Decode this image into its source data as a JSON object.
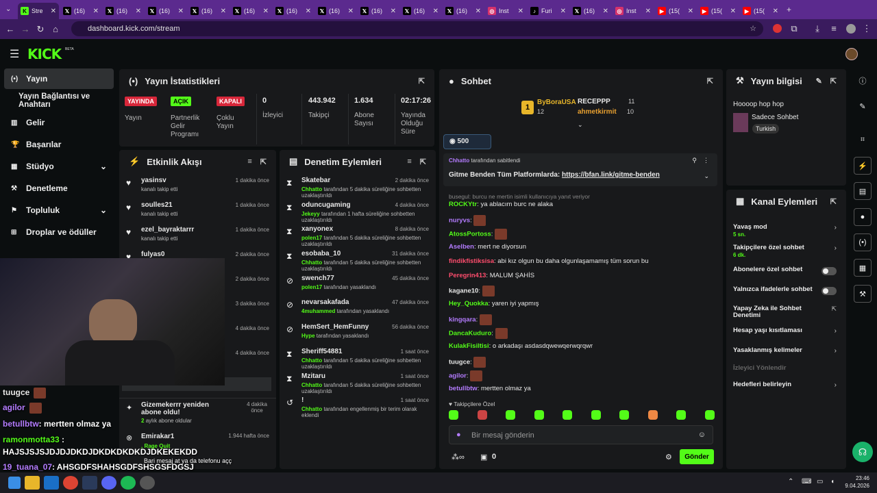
{
  "browser": {
    "tabs": [
      {
        "label": "Stre",
        "icon": "kick-icon",
        "color": "#53fc18",
        "active": true
      },
      {
        "label": "(16)",
        "icon": "x-icon"
      },
      {
        "label": "(16)",
        "icon": "x-icon"
      },
      {
        "label": "(16)",
        "icon": "x-icon"
      },
      {
        "label": "(16)",
        "icon": "x-icon"
      },
      {
        "label": "(16)",
        "icon": "x-icon"
      },
      {
        "label": "(16)",
        "icon": "x-icon"
      },
      {
        "label": "(16)",
        "icon": "x-icon"
      },
      {
        "label": "(16)",
        "icon": "x-icon"
      },
      {
        "label": "(16)",
        "icon": "x-icon"
      },
      {
        "label": "(16)",
        "icon": "x-icon"
      },
      {
        "label": "Inst",
        "icon": "instagram-icon"
      },
      {
        "label": "Furi",
        "icon": "tiktok-icon"
      },
      {
        "label": "(16)",
        "icon": "x-icon"
      },
      {
        "label": "Inst",
        "icon": "instagram-icon"
      },
      {
        "label": "(15(",
        "icon": "youtube-icon"
      },
      {
        "label": "(15(",
        "icon": "youtube-icon"
      },
      {
        "label": "(15(",
        "icon": "youtube-icon"
      }
    ],
    "url": "dashboard.kick.com/stream"
  },
  "kick": {
    "logo": "KICK",
    "beta": "BETA"
  },
  "sidebar": {
    "items": [
      {
        "label": "Yayın",
        "icon": "broadcast-icon",
        "active": true
      },
      {
        "label": "Yayın Bağlantısı ve Anahtarı",
        "icon": ""
      },
      {
        "label": "Gelir",
        "icon": "revenue-icon"
      },
      {
        "label": "Başarılar",
        "icon": "trophy-icon"
      },
      {
        "label": "Stüdyo",
        "icon": "studio-icon",
        "chev": true
      },
      {
        "label": "Denetleme",
        "icon": "wrench-icon"
      },
      {
        "label": "Topluluk",
        "icon": "community-icon",
        "chev": true
      },
      {
        "label": "Droplar ve ödüller",
        "icon": "gift-icon"
      }
    ]
  },
  "stats": {
    "title": "Yayın İstatistikleri",
    "live_badge": "YAYINDA",
    "live_label": "Yayın",
    "partner_badge": "AÇIK",
    "partner_label": "Partnerlik Gelir Programı",
    "multi_badge": "KAPALI",
    "multi_label": "Çoklu Yayın",
    "viewers": "0",
    "viewers_label": "İzleyici",
    "followers": "443.942",
    "followers_label": "Takipçi",
    "subs": "1.634",
    "subs_label": "Abone Sayısı",
    "uptime": "02:17:26",
    "uptime_label": "Yayında Olduğu Süre"
  },
  "activity": {
    "title": "Etkinlik Akışı",
    "items": [
      {
        "name": "yasinsv",
        "sub": "kanalı takip etti",
        "time": "1 dakika önce"
      },
      {
        "name": "soulles21",
        "sub": "kanalı takip etti",
        "time": "1 dakika önce"
      },
      {
        "name": "ezel_bayraktarrr",
        "sub": "kanalı takip etti",
        "time": "1 dakika önce"
      },
      {
        "name": "fulyas0",
        "sub": "",
        "time": "2 dakika önce"
      },
      {
        "name": "",
        "sub": "",
        "time": "2 dakika önce"
      },
      {
        "name": "",
        "sub": "",
        "time": "3 dakika önce"
      },
      {
        "name": "",
        "sub": "",
        "time": "4 dakika önce"
      },
      {
        "name": "",
        "sub": "oplam abonelik",
        "time": "4 dakika önce"
      }
    ],
    "sub_event": {
      "name": "Gizemekerrr yeniden abone oldu!",
      "months": "2",
      "sub": "aylık abone oldular",
      "time": "4 dakika önce"
    },
    "raid": {
      "name": "Emirakar1",
      "sub": ", Rage Quit",
      "time": "1.944 hafta önce"
    }
  },
  "moderation": {
    "title": "Denetim Eylemleri",
    "items": [
      {
        "name": "Skatebar",
        "mod": "Chhatto",
        "sub": "tarafından 5 dakika süreliğine sohbetten uzaklaştırıldı",
        "time": "2 dakika önce",
        "icon": "hourglass-icon"
      },
      {
        "name": "oduncugaming",
        "mod": "Jekeyy",
        "sub": "tarafından 1 hafta süreliğine sohbetten uzaklaştırıldı",
        "time": "4 dakika önce",
        "icon": "hourglass-icon"
      },
      {
        "name": "xanyonex",
        "mod": "polen17",
        "sub": "tarafından 5 dakika süreliğine sohbetten uzaklaştırıldı",
        "time": "8 dakika önce",
        "icon": "hourglass-icon"
      },
      {
        "name": "esobaba_10",
        "mod": "Chhatto",
        "sub": "tarafından 5 dakika süreliğine sohbetten uzaklaştırıldı",
        "time": "31 dakika önce",
        "icon": "hourglass-icon"
      },
      {
        "name": "swench77",
        "mod": "polen17",
        "sub": "tarafından yasaklandı",
        "time": "45 dakika önce",
        "icon": "ban-icon"
      },
      {
        "name": "nevarsakafada",
        "mod": "4muhammed",
        "sub": "tarafından yasaklandı",
        "time": "47 dakika önce",
        "icon": "ban-icon"
      },
      {
        "name": "HemSert_HemFunny",
        "mod": "Hype",
        "sub": "tarafından yasaklandı",
        "time": "56 dakika önce",
        "icon": "ban-icon"
      },
      {
        "name": "Sheriff54881",
        "mod": "Chhatto",
        "sub": "tarafından 5 dakika süreliğine sohbetten uzaklaştırıldı",
        "time": "1 saat önce",
        "icon": "hourglass-icon"
      },
      {
        "name": "Mzitaru",
        "mod": "Chhatto",
        "sub": "tarafından 5 dakika süreliğine sohbetten uzaklaştırıldı",
        "time": "1 saat önce",
        "icon": "hourglass-icon"
      },
      {
        "name": "!",
        "mod": "Chhatto",
        "sub": "tarafından engellenmiş bir terim olarak eklendi",
        "time": "1 saat önce",
        "icon": "undo-icon"
      }
    ]
  },
  "chat": {
    "title": "Sohbet",
    "top1": {
      "name": "ByBoraUSA",
      "count": "12"
    },
    "top2": {
      "name": "RECEPPP",
      "count": "11"
    },
    "top3": {
      "name": "ahmetkirmit",
      "count": "10"
    },
    "goal": "500",
    "pinned_by": "Chhatto",
    "pinned_suffix": "tarafından sabitlendi",
    "pinned_text": "Gitme Benden Tüm Platformlarda:",
    "pinned_link": "https://bfan.link/gitme-benden",
    "reply_hint": "busegul: burcu ne mertin isimli kullanıcıya yanıt veriyor",
    "messages": [
      {
        "user": "ROCKYtr",
        "color": "#53fc18",
        "text": "ya ablacım burc ne alaka"
      },
      {
        "user": "nuryvs",
        "color": "#b47cff",
        "text": "",
        "emote": true
      },
      {
        "user": "AtossPortoss",
        "color": "#53fc18",
        "text": "",
        "emote": true
      },
      {
        "user": "Aselben",
        "color": "#b47cff",
        "text": "mert ne diyorsun"
      },
      {
        "user": "findikfistiksisa",
        "color": "#ff4d6d",
        "text": "abi kız olgun bu daha olgunlaşamamış tüm sorun bu"
      },
      {
        "user": "Peregrin413",
        "color": "#ff4d6d",
        "text": "MALUM ŞAHİS"
      },
      {
        "user": "kagane10",
        "color": "#e8e8e8",
        "text": "",
        "emote": true
      },
      {
        "user": "Hey_Quokka",
        "color": "#53fc18",
        "text": "yaren iyi yapmış"
      },
      {
        "user": "kingqara",
        "color": "#b47cff",
        "text": "",
        "emote": true
      },
      {
        "user": "DancaKuduro",
        "color": "#53fc18",
        "text": "",
        "emote": true
      },
      {
        "user": "KulakFisiltisi",
        "color": "#53fc18",
        "text": "o arkadaşı asdasdqwewqerwqrqwr"
      },
      {
        "user": "tuugce",
        "color": "#e8e8e8",
        "text": "",
        "emote": true
      },
      {
        "user": "agilor",
        "color": "#b47cff",
        "text": "",
        "emote": true
      },
      {
        "user": "betullbtw",
        "color": "#b47cff",
        "text": "mertten olmaz ya"
      }
    ],
    "followers_only": "Takipçilere Özel",
    "input_placeholder": "Bir mesaj gönderin",
    "points": "0",
    "send_label": "Gönder"
  },
  "stream_info": {
    "title": "Yayın bilgisi",
    "stream_title": "Hoooop hop hop",
    "category": "Sadece Sohbet",
    "tag": "Turkish"
  },
  "channel_actions": {
    "title": "Kanal Eylemleri",
    "items": [
      {
        "label": "Yavaş mod",
        "sub": "5 sn.",
        "kind": "chev"
      },
      {
        "label": "Takipçilere özel sohbet",
        "sub": "6 dk.",
        "kind": "chev"
      },
      {
        "label": "Abonelere özel sohbet",
        "sub": "",
        "kind": "toggle"
      },
      {
        "label": "Yalnızca ifadelerle sohbet",
        "sub": "",
        "kind": "toggle"
      },
      {
        "label": "Yapay Zeka ile Sohbet Denetimi",
        "sub": "",
        "kind": "ext"
      },
      {
        "label": "Hesap yaşı kısıtlaması",
        "sub": "",
        "kind": "chev"
      },
      {
        "label": "Yasaklanmış kelimeler",
        "sub": "",
        "kind": "chev"
      },
      {
        "label": "İzleyici Yönlendir",
        "sub": "",
        "kind": "disabled"
      },
      {
        "label": "Hedefleri belirleyin",
        "sub": "",
        "kind": "chev"
      }
    ]
  },
  "overlay": {
    "lines": [
      {
        "user": "tuugce",
        "color": "#e8e8e8",
        "text": ""
      },
      {
        "user": "agilor",
        "color": "#b47cff",
        "text": ""
      },
      {
        "user": "betullbtw",
        "color": "#b47cff",
        "text": ": mertten olmaz ya"
      },
      {
        "user": "ramonmotta33",
        "color": "#53fc18",
        "text": " :"
      },
      {
        "user": "",
        "color": "#ffffff",
        "text": "HAJSJSJSJDJDJDKDJDKDKDKDKDJDKEKEKDD"
      },
      {
        "user": "19_tuana_07",
        "color": "#b47cff",
        "text": ": AHSGDFSHAHSGDFSHSGSFDGSJ"
      }
    ],
    "caption": "Bari mesaj at ya da telefonu açç"
  },
  "taskbar": {
    "time": "23:46",
    "date": "9.04.2026"
  }
}
